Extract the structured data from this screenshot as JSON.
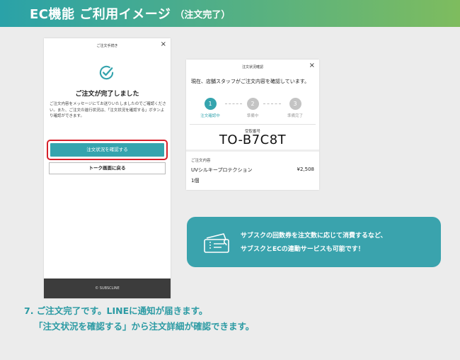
{
  "banner": {
    "title": "EC機能 ご利用イメージ",
    "subtitle": "（注文完了）"
  },
  "phone1": {
    "title": "ご注文手続き",
    "close": "×",
    "check_icon": "check-circle-icon",
    "heading": "ご注文が完了しました",
    "body": "ご注文内容をメッセージにてお送りいたしましたのでご確認ください。また、ご注文の進行状況は、「注文状況を確認する」ボタンより確認ができます。",
    "primary_button": "注文状況を確認する",
    "secondary_button": "トーク画面に戻る",
    "footer": "© SUBSCLINE",
    "highlight_color": "#d6202a",
    "accent_color": "#35a4ae"
  },
  "phone2": {
    "title": "注文状況確認",
    "close": "×",
    "message": "現在、店舗スタッフがご注文内容を確認しています。",
    "steps": [
      {
        "number": "1",
        "label": "注文確認中",
        "active": true
      },
      {
        "number": "2",
        "label": "準備中",
        "active": false
      },
      {
        "number": "3",
        "label": "準備完了",
        "active": false
      }
    ],
    "receipt_label": "受取番号",
    "receipt_number": "TO-B7C8T",
    "order_label": "ご注文内容",
    "item_name": "UVシルキープロテクション",
    "item_price": "¥2,508",
    "item_qty": "1個"
  },
  "info": {
    "icon": "coupon-ticket-icon",
    "line1": "サブスクの回数券を注文数に応じて消費するなど、",
    "line2": "サブスクとECの連動サービスも可能です！"
  },
  "caption": {
    "line1": "7. ご注文完了です。LINEに通知が届きます。",
    "line2": "「注文状況を確認する」から注文詳細が確認できます。"
  }
}
